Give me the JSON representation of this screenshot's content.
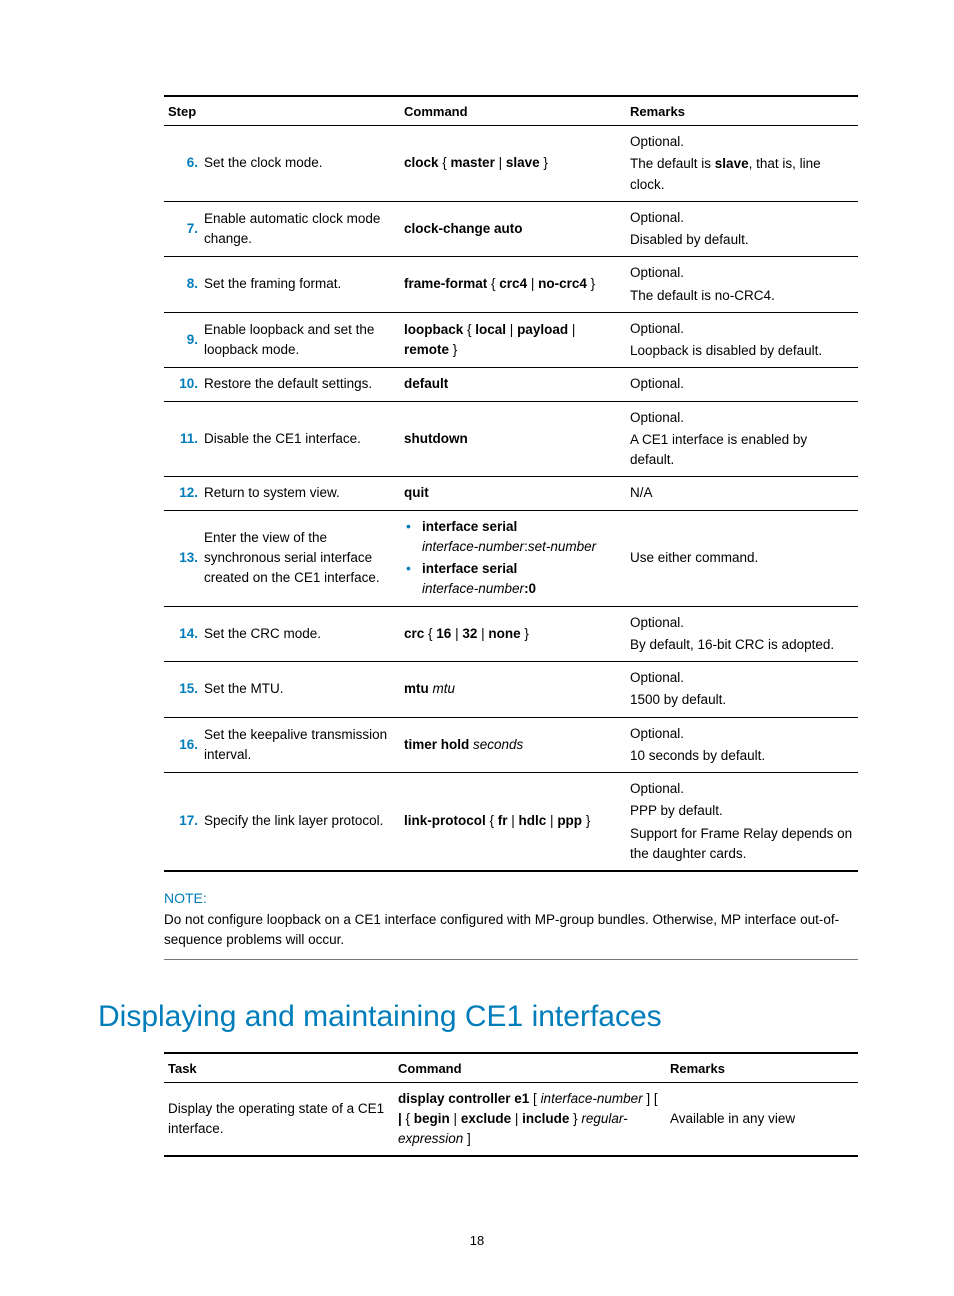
{
  "table1": {
    "headers": {
      "step": "Step",
      "command": "Command",
      "remarks": "Remarks"
    },
    "rows": {
      "r6": {
        "num": "6.",
        "desc": "Set the clock mode.",
        "cmd_b1": "clock",
        "cmd_t1": " { ",
        "cmd_b2": "master",
        "cmd_t2": " | ",
        "cmd_b3": "slave",
        "cmd_t3": " }",
        "rem1": "Optional.",
        "rem2a": "The default is ",
        "rem2b": "slave",
        "rem2c": ", that is, line clock."
      },
      "r7": {
        "num": "7.",
        "desc": "Enable automatic clock mode change.",
        "cmd_b1": "clock-change auto",
        "rem1": "Optional.",
        "rem2": "Disabled by default."
      },
      "r8": {
        "num": "8.",
        "desc": "Set the framing format.",
        "cmd_b1": "frame-format",
        "cmd_t1": " { ",
        "cmd_b2": "crc4",
        "cmd_t2": " | ",
        "cmd_b3": "no-crc4",
        "cmd_t3": " }",
        "rem1": "Optional.",
        "rem2": "The default is no-CRC4."
      },
      "r9": {
        "num": "9.",
        "desc": "Enable loopback and set the loopback mode.",
        "cmd_b1": "loopback",
        "cmd_t1": " { ",
        "cmd_b2": "local",
        "cmd_t2": " | ",
        "cmd_b3": "payload",
        "cmd_t3": " | ",
        "cmd_b4": "remote",
        "cmd_t4": " }",
        "rem1": "Optional.",
        "rem2": "Loopback is disabled by default."
      },
      "r10": {
        "num": "10.",
        "desc": "Restore the default settings.",
        "cmd_b1": "default",
        "rem1": "Optional."
      },
      "r11": {
        "num": "11.",
        "desc": "Disable the CE1 interface.",
        "cmd_b1": "shutdown",
        "rem1": "Optional.",
        "rem2": "A CE1 interface is enabled by default."
      },
      "r12": {
        "num": "12.",
        "desc": "Return to system view.",
        "cmd_b1": "quit",
        "rem1": "N/A"
      },
      "r13": {
        "num": "13.",
        "desc": "Enter the view of the synchronous serial interface created on the CE1 interface.",
        "li1_b": "interface serial",
        "li1_i": "interface-number",
        "li1_t": ":",
        "li1_i2": "set-number",
        "li2_b": "interface serial",
        "li2_i": "interface-number",
        "li2_bt": ":0",
        "rem1": "Use either command."
      },
      "r14": {
        "num": "14.",
        "desc": "Set the CRC mode.",
        "cmd_b1": "crc",
        "cmd_t1": " { ",
        "cmd_b2": "16",
        "cmd_t2": " | ",
        "cmd_b3": "32",
        "cmd_t3": " | ",
        "cmd_b4": "none",
        "cmd_t4": " }",
        "rem1": "Optional.",
        "rem2": "By default, 16-bit CRC is adopted."
      },
      "r15": {
        "num": "15.",
        "desc": "Set the MTU.",
        "cmd_b1": "mtu",
        "cmd_i1": " mtu",
        "rem1": "Optional.",
        "rem2": "1500 by default."
      },
      "r16": {
        "num": "16.",
        "desc": "Set the keepalive transmission interval.",
        "cmd_b1": "timer hold",
        "cmd_i1": " seconds",
        "rem1": "Optional.",
        "rem2": "10 seconds by default."
      },
      "r17": {
        "num": "17.",
        "desc": "Specify the link layer protocol.",
        "cmd_b1": "link-protocol",
        "cmd_t1": " { ",
        "cmd_b2": "fr",
        "cmd_t2": " | ",
        "cmd_b3": "hdlc",
        "cmd_t3": " | ",
        "cmd_b4": "ppp",
        "cmd_t4": " }",
        "rem1": "Optional.",
        "rem2": "PPP by default.",
        "rem3": "Support for Frame Relay depends on the daughter cards."
      }
    }
  },
  "note": {
    "label": "NOTE:",
    "text": "Do not configure loopback on a CE1 interface configured with MP-group bundles. Otherwise, MP interface out-of-sequence problems will occur."
  },
  "section_heading": "Displaying and maintaining CE1 interfaces",
  "table2": {
    "headers": {
      "task": "Task",
      "command": "Command",
      "remarks": "Remarks"
    },
    "row": {
      "task": "Display the operating state of a CE1 interface.",
      "c_b1": "display controller e1",
      "c_t1": " [ ",
      "c_i1": "interface-number",
      "c_t2": " ] [ ",
      "c_b2": "|",
      "c_t3": " { ",
      "c_b3": "begin",
      "c_t4": " | ",
      "c_b4": "exclude",
      "c_t5": " | ",
      "c_b5": "include",
      "c_t6": " } ",
      "c_i2": "regular-expression",
      "c_t7": " ]",
      "remarks": "Available in any view"
    }
  },
  "page_number": "18"
}
